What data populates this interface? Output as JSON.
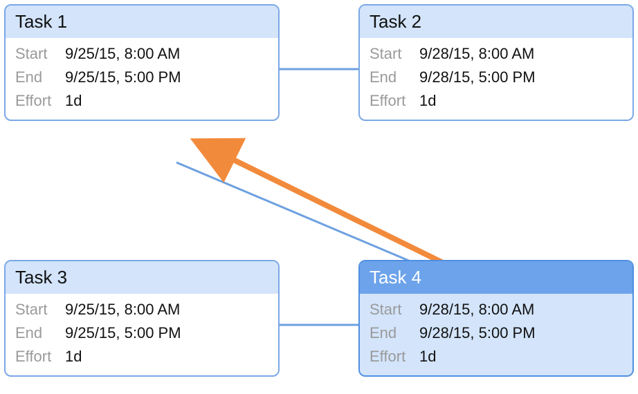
{
  "labels": {
    "start": "Start",
    "end": "End",
    "effort": "Effort"
  },
  "tasks": {
    "task1": {
      "title": "Task 1",
      "start": "9/25/15, 8:00 AM",
      "end": "9/25/15, 5:00 PM",
      "effort": "1d",
      "selected": false
    },
    "task2": {
      "title": "Task 2",
      "start": "9/28/15, 8:00 AM",
      "end": "9/28/15, 5:00 PM",
      "effort": "1d",
      "selected": false
    },
    "task3": {
      "title": "Task 3",
      "start": "9/25/15, 8:00 AM",
      "end": "9/25/15, 5:00 PM",
      "effort": "1d",
      "selected": false
    },
    "task4": {
      "title": "Task 4",
      "start": "9/28/15, 8:00 AM",
      "end": "9/28/15, 5:00 PM",
      "effort": "1d",
      "selected": true
    }
  },
  "connectors": [
    {
      "from": "task1",
      "to": "task2"
    },
    {
      "from": "task3",
      "to": "task4"
    },
    {
      "from": "task4",
      "to": "task1_hint",
      "style": "pending"
    }
  ],
  "colors": {
    "connector_blue": "#6ea0e0",
    "arrow_orange": "#f28a3c",
    "card_border": "#7aa8e6",
    "card_header": "#d3e4fb",
    "selected_border": "#4f8fe0",
    "selected_header": "#6ca3eb"
  }
}
